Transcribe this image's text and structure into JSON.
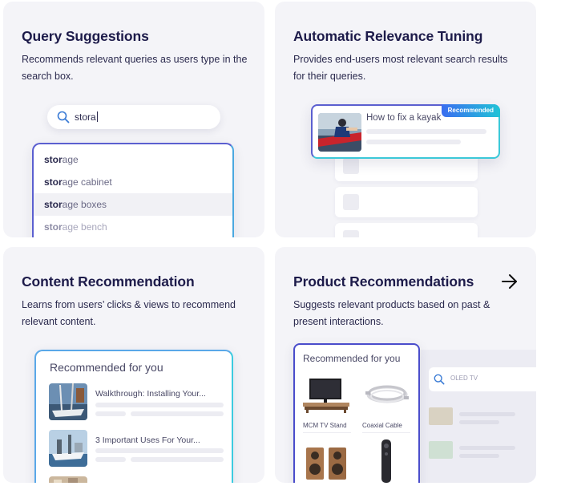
{
  "cards": {
    "query_suggestions": {
      "title": "Query Suggestions",
      "description": "Recommends relevant queries as users type in the search box.",
      "search": {
        "value": "stora"
      },
      "suggestions": [
        {
          "bold": "stor",
          "rest": "age"
        },
        {
          "bold": "stor",
          "rest": "age cabinet"
        },
        {
          "bold": "stor",
          "rest": "age boxes"
        },
        {
          "bold": "stor",
          "rest": "age bench"
        }
      ]
    },
    "automatic_relevance": {
      "title": "Automatic Relevance Tuning",
      "description": "Provides end-users most relevant search results for their queries.",
      "result_title": "How to fix a kayak",
      "badge": "Recommended"
    },
    "content_recommendation": {
      "title": "Content Recommendation",
      "description": "Learns from users’ clicks & views to recommend relevant content.",
      "heading": "Recommended for you",
      "items": [
        {
          "title": "Walkthrough: Installing Your..."
        },
        {
          "title": "3 Important Uses For Your..."
        }
      ]
    },
    "product_recommendations": {
      "title": "Product Recommendations",
      "description": "Suggests relevant products based on past & present interactions.",
      "heading": "Recommended for you",
      "search_placeholder": "OLED TV",
      "products": [
        {
          "label": "MCM TV Stand"
        },
        {
          "label": "Coaxial Cable"
        }
      ]
    }
  },
  "colors": {
    "card_bg": "#f4f4f8",
    "title": "#1d1b4a",
    "accent_blue": "#4a4dcb",
    "accent_cyan": "#3cc8d8"
  }
}
